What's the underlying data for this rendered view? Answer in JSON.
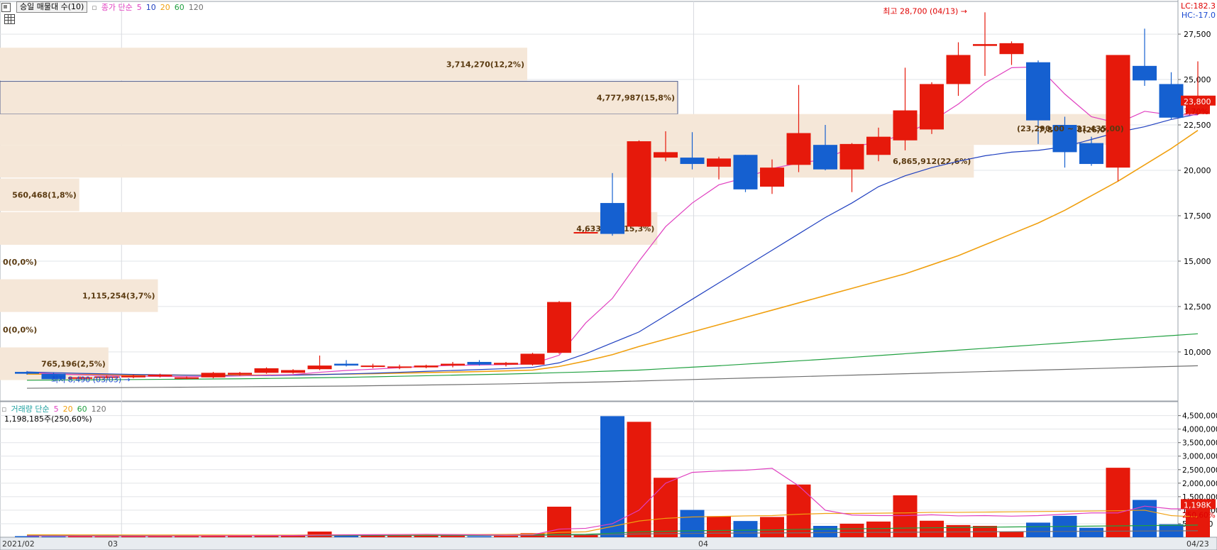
{
  "toolbar": {
    "indicator": "승일 매물대 수(10)",
    "ma_label": "종가 단순",
    "periods": [
      "5",
      "10",
      "20",
      "60",
      "120"
    ]
  },
  "volume_toolbar": {
    "label": "거래량 단순",
    "periods": [
      "5",
      "20",
      "60",
      "120"
    ],
    "total": "1,198,185주(250,60%)"
  },
  "corner": {
    "lc": "LC:182.3",
    "hc": "HC:-17.0"
  },
  "colors": {
    "up": "#e6190b",
    "down": "#1560d0",
    "ma5": "#e040c0",
    "ma10": "#2040c0",
    "ma20": "#f0a010",
    "ma60": "#20a040",
    "ma120": "#707070",
    "band": "#f5e7d8"
  },
  "chart_data": {
    "type": "candlestick",
    "x_axis_labels": [
      "2021/02",
      "03",
      "04",
      "04/23"
    ],
    "price_axis": {
      "ticks": [
        "27,500",
        "25,000",
        "22,500",
        "20,000",
        "17,500",
        "15,000",
        "12,500",
        "10,000"
      ],
      "ylim": [
        7300,
        29300
      ]
    },
    "volume_axis": {
      "ticks": [
        "4,500,000",
        "4,000,000",
        "3,500,000",
        "3,000,000",
        "2,500,000",
        "2,000,000",
        "1,500,000",
        "1,000,000",
        "500,000"
      ],
      "ylim": [
        0,
        4700000
      ]
    },
    "candles": [
      {
        "o": 8900,
        "h": 8950,
        "l": 8750,
        "c": 8800
      },
      {
        "o": 8800,
        "h": 8850,
        "l": 8490,
        "c": 8500
      },
      {
        "o": 8550,
        "h": 8650,
        "l": 8500,
        "c": 8600
      },
      {
        "o": 8600,
        "h": 8700,
        "l": 8550,
        "c": 8650
      },
      {
        "o": 8600,
        "h": 8750,
        "l": 8550,
        "c": 8700
      },
      {
        "o": 8650,
        "h": 8800,
        "l": 8600,
        "c": 8750
      },
      {
        "o": 8550,
        "h": 8650,
        "l": 8500,
        "c": 8600
      },
      {
        "o": 8600,
        "h": 8900,
        "l": 8550,
        "c": 8850
      },
      {
        "o": 8750,
        "h": 8900,
        "l": 8700,
        "c": 8850
      },
      {
        "o": 8850,
        "h": 9150,
        "l": 8800,
        "c": 9100
      },
      {
        "o": 8850,
        "h": 9050,
        "l": 8800,
        "c": 9000
      },
      {
        "o": 9050,
        "h": 9800,
        "l": 9000,
        "c": 9250
      },
      {
        "o": 9350,
        "h": 9550,
        "l": 9200,
        "c": 9250
      },
      {
        "o": 9200,
        "h": 9350,
        "l": 9100,
        "c": 9250
      },
      {
        "o": 9150,
        "h": 9300,
        "l": 9050,
        "c": 9200
      },
      {
        "o": 9150,
        "h": 9300,
        "l": 9100,
        "c": 9250
      },
      {
        "o": 9250,
        "h": 9450,
        "l": 9150,
        "c": 9350
      },
      {
        "o": 9450,
        "h": 9550,
        "l": 9250,
        "c": 9300
      },
      {
        "o": 9300,
        "h": 9450,
        "l": 9200,
        "c": 9400
      },
      {
        "o": 9300,
        "h": 9950,
        "l": 9250,
        "c": 9900
      },
      {
        "o": 9950,
        "h": 12800,
        "l": 9900,
        "c": 12750
      },
      {
        "o": 16550,
        "h": 16700,
        "l": 16550,
        "c": 16600
      },
      {
        "o": 18200,
        "h": 19850,
        "l": 16400,
        "c": 16500
      },
      {
        "o": 16900,
        "h": 21650,
        "l": 16900,
        "c": 21600
      },
      {
        "o": 20700,
        "h": 22150,
        "l": 20500,
        "c": 21000
      },
      {
        "o": 20700,
        "h": 22100,
        "l": 20050,
        "c": 20350
      },
      {
        "o": 20200,
        "h": 20750,
        "l": 19500,
        "c": 20650
      },
      {
        "o": 20850,
        "h": 20850,
        "l": 18800,
        "c": 18950
      },
      {
        "o": 19100,
        "h": 20600,
        "l": 18700,
        "c": 20150
      },
      {
        "o": 20300,
        "h": 24700,
        "l": 19900,
        "c": 22050
      },
      {
        "o": 21400,
        "h": 22500,
        "l": 20000,
        "c": 20050
      },
      {
        "o": 20050,
        "h": 21500,
        "l": 18800,
        "c": 21450
      },
      {
        "o": 20850,
        "h": 22350,
        "l": 20500,
        "c": 21850
      },
      {
        "o": 21650,
        "h": 25650,
        "l": 21100,
        "c": 23300
      },
      {
        "o": 22250,
        "h": 24850,
        "l": 22000,
        "c": 24750
      },
      {
        "o": 24750,
        "h": 27050,
        "l": 24100,
        "c": 26350
      },
      {
        "o": 26850,
        "h": 28700,
        "l": 25200,
        "c": 26950
      },
      {
        "o": 26400,
        "h": 27100,
        "l": 25800,
        "c": 27000
      },
      {
        "o": 25950,
        "h": 26050,
        "l": 21450,
        "c": 22750
      },
      {
        "o": 22500,
        "h": 22950,
        "l": 20150,
        "c": 21000
      },
      {
        "o": 21500,
        "h": 21850,
        "l": 20250,
        "c": 20350
      },
      {
        "o": 20150,
        "h": 26350,
        "l": 19400,
        "c": 26350
      },
      {
        "o": 25750,
        "h": 27800,
        "l": 24650,
        "c": 24950
      },
      {
        "o": 24750,
        "h": 25400,
        "l": 22800,
        "c": 22900
      },
      {
        "o": 23100,
        "h": 26000,
        "l": 23050,
        "c": 23800
      }
    ],
    "ma5": [
      8860,
      8800,
      8740,
      8700,
      8660,
      8650,
      8640,
      8650,
      8680,
      8720,
      8750,
      8880,
      8980,
      9050,
      9130,
      9210,
      9260,
      9280,
      9300,
      9350,
      9820,
      11600,
      12950,
      15000,
      16900,
      18200,
      19200,
      19600,
      20100,
      20400,
      20600,
      21300,
      21550,
      22000,
      22700,
      23650,
      24800,
      25650,
      25700,
      24200,
      22950,
      22600,
      23250,
      23050,
      23050
    ],
    "ma10": [
      8900,
      8860,
      8820,
      8790,
      8760,
      8740,
      8720,
      8700,
      8690,
      8700,
      8720,
      8750,
      8790,
      8830,
      8880,
      8930,
      8980,
      9030,
      9080,
      9150,
      9400,
      9900,
      10500,
      11100,
      12000,
      12900,
      13800,
      14700,
      15600,
      16500,
      17400,
      18200,
      19100,
      19700,
      20150,
      20500,
      20800,
      21000,
      21100,
      21300,
      21700,
      22100,
      22400,
      22800,
      23100
    ],
    "ma20": [
      8780,
      8770,
      8760,
      8750,
      8740,
      8730,
      8720,
      8720,
      8720,
      8730,
      8740,
      8760,
      8780,
      8800,
      8830,
      8860,
      8890,
      8920,
      8960,
      9000,
      9200,
      9500,
      9850,
      10300,
      10700,
      11100,
      11500,
      11900,
      12300,
      12700,
      13100,
      13500,
      13900,
      14300,
      14800,
      15300,
      15900,
      16500,
      17100,
      17800,
      18600,
      19400,
      20300,
      21200,
      22200
    ],
    "ma60": [
      8440,
      8450,
      8460,
      8470,
      8480,
      8490,
      8500,
      8510,
      8520,
      8540,
      8560,
      8580,
      8600,
      8630,
      8660,
      8690,
      8720,
      8750,
      8780,
      8820,
      8860,
      8900,
      8950,
      9000,
      9080,
      9160,
      9240,
      9330,
      9420,
      9510,
      9600,
      9700,
      9800,
      9900,
      10000,
      10100,
      10200,
      10300,
      10400,
      10500,
      10600,
      10700,
      10800,
      10900,
      11000
    ],
    "ma120": [
      8000,
      8010,
      8020,
      8030,
      8040,
      8050,
      8060,
      8070,
      8080,
      8090,
      8100,
      8110,
      8120,
      8140,
      8160,
      8180,
      8200,
      8220,
      8240,
      8270,
      8300,
      8330,
      8360,
      8400,
      8440,
      8480,
      8520,
      8560,
      8600,
      8640,
      8680,
      8720,
      8760,
      8800,
      8840,
      8880,
      8920,
      8960,
      9000,
      9040,
      9080,
      9120,
      9160,
      9200,
      9240
    ],
    "volumes": [
      40000,
      30000,
      50000,
      30000,
      60000,
      40000,
      50000,
      60000,
      60000,
      90000,
      60000,
      210000,
      70000,
      60000,
      50000,
      80000,
      50000,
      40000,
      50000,
      150000,
      1130000,
      90000,
      4480000,
      4270000,
      2200000,
      1010000,
      780000,
      600000,
      750000,
      1950000,
      420000,
      500000,
      580000,
      1550000,
      610000,
      450000,
      420000,
      200000,
      540000,
      790000,
      350000,
      2570000,
      1380000,
      480000,
      1200000
    ],
    "vol_ma5": [
      50000,
      48000,
      46000,
      44000,
      45000,
      45000,
      48000,
      52000,
      55000,
      60000,
      62000,
      80000,
      90000,
      95000,
      100000,
      110000,
      100000,
      90000,
      80000,
      90000,
      300000,
      330000,
      500000,
      1000000,
      2000000,
      2400000,
      2450000,
      2480000,
      2550000,
      1900000,
      1000000,
      820000,
      800000,
      800000,
      830000,
      790000,
      800000,
      780000,
      800000,
      850000,
      900000,
      900000,
      1150000,
      1050000,
      1050000
    ],
    "vol_ma20": [
      90000,
      88000,
      86000,
      85000,
      84000,
      83000,
      82000,
      82000,
      81000,
      80000,
      80000,
      90000,
      92000,
      94000,
      96000,
      98000,
      100000,
      100000,
      105000,
      120000,
      180000,
      200000,
      400000,
      600000,
      700000,
      750000,
      770000,
      790000,
      800000,
      850000,
      880000,
      880000,
      890000,
      900000,
      920000,
      920000,
      930000,
      940000,
      950000,
      960000,
      970000,
      980000,
      1000000,
      800000,
      750000
    ],
    "vol_ma60": [
      70000,
      70000,
      70000,
      70000,
      70000,
      70000,
      70000,
      70000,
      70000,
      70000,
      70000,
      75000,
      76000,
      77000,
      78000,
      79000,
      80000,
      80000,
      82000,
      85000,
      100000,
      110000,
      150000,
      200000,
      220000,
      240000,
      250000,
      260000,
      270000,
      290000,
      300000,
      310000,
      320000,
      340000,
      350000,
      360000,
      370000,
      380000,
      390000,
      400000,
      410000,
      420000,
      430000,
      440000,
      450000
    ],
    "vol_ma120": [
      60000,
      60000,
      60000,
      60000,
      60000,
      60000,
      60000,
      60000,
      60000,
      60000,
      60000,
      62000,
      63000,
      64000,
      65000,
      66000,
      67000,
      68000,
      70000,
      72000,
      80000,
      85000,
      100000,
      120000,
      130000,
      140000,
      150000,
      155000,
      160000,
      165000,
      170000,
      175000,
      180000,
      185000,
      190000,
      195000,
      200000,
      205000,
      210000,
      215000,
      220000,
      225000,
      230000,
      235000,
      240000
    ],
    "volume_profile": [
      {
        "label": "3,714,270(12,2%)",
        "from": 24950,
        "to": 26750,
        "share": 0.778,
        "edge": "right"
      },
      {
        "label": "4,777,987(15,8%)",
        "from": 23100,
        "to": 24900,
        "share": 1.0,
        "edge": "right"
      },
      {
        "label": "7,896,938(26,0%)",
        "from": 21400,
        "to": 23100,
        "share": 1.652,
        "edge": "right"
      },
      {
        "label": "6,865,912(22,6%)",
        "from": 19600,
        "to": 21400,
        "share": 1.437,
        "edge": "right"
      },
      {
        "label": "560,468(1,8%)",
        "from": 17750,
        "to": 19550,
        "share": 0.117,
        "edge": "right"
      },
      {
        "label": "4,633,220(15,3%)",
        "from": 15900,
        "to": 17700,
        "share": 0.97,
        "edge": "right"
      },
      {
        "label": "0(0,0%)",
        "from": 14050,
        "to": 15850,
        "share": 0,
        "edge": "left"
      },
      {
        "label": "1,115,254(3,7%)",
        "from": 12200,
        "to": 14000,
        "share": 0.233,
        "edge": "right"
      },
      {
        "label": "0(0,0%)",
        "from": 10300,
        "to": 12150,
        "share": 0,
        "edge": "left"
      },
      {
        "label": "765,196(2,5%)",
        "from": 8450,
        "to": 10250,
        "share": 0.16,
        "edge": "right"
      }
    ],
    "annotations": {
      "high": "최고 28,700 (04/13)",
      "low": "최저 8,490 (03/03)",
      "range": "(23,290,00 ~ 21,435,00)",
      "last_price": "23,800",
      "last_pct": "3,70%",
      "last_volume": "1,198K",
      "last_vol_pct": "250,60%"
    }
  }
}
